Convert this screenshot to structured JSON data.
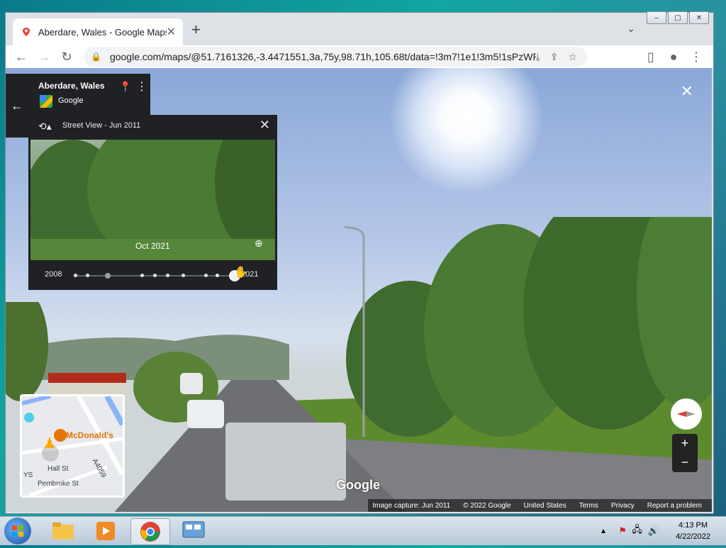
{
  "browser": {
    "tab_title": "Aberdare, Wales - Google Maps",
    "tab_close": "✕",
    "new_tab": "+",
    "tab_list": "⌄",
    "url": "google.com/maps/@51.7161326,-3.4471551,3a,75y,98.71h,105.68t/data=!3m7!1e1!3m5!1sPzWRjgwP...",
    "window_controls": [
      "–",
      "▢",
      "✕"
    ]
  },
  "place_card": {
    "title": "Aberdare, Wales",
    "source": "Google"
  },
  "time_machine": {
    "title": "Street View - Jun 2011",
    "thumbnail_date": "Oct 2021",
    "start_year": "2008",
    "end_year": "2021",
    "selected_fraction": 1.0
  },
  "minimap": {
    "poi": "McDonald's",
    "street1": "Hall St",
    "street2": "Pembroke St",
    "road": "A4059",
    "edge": "YS"
  },
  "watermark": "Google",
  "footer": {
    "capture": "Image capture: Jun 2011",
    "copyright": "© 2022 Google",
    "country": "United States",
    "terms": "Terms",
    "privacy": "Privacy",
    "report": "Report a problem"
  },
  "taskbar": {
    "time": "4:13 PM",
    "date": "4/22/2022"
  },
  "colors": {
    "panel_bg": "#202124",
    "omnibox_bg": "#f1f3f4",
    "taskbar_bg": "#c9d6e2"
  }
}
